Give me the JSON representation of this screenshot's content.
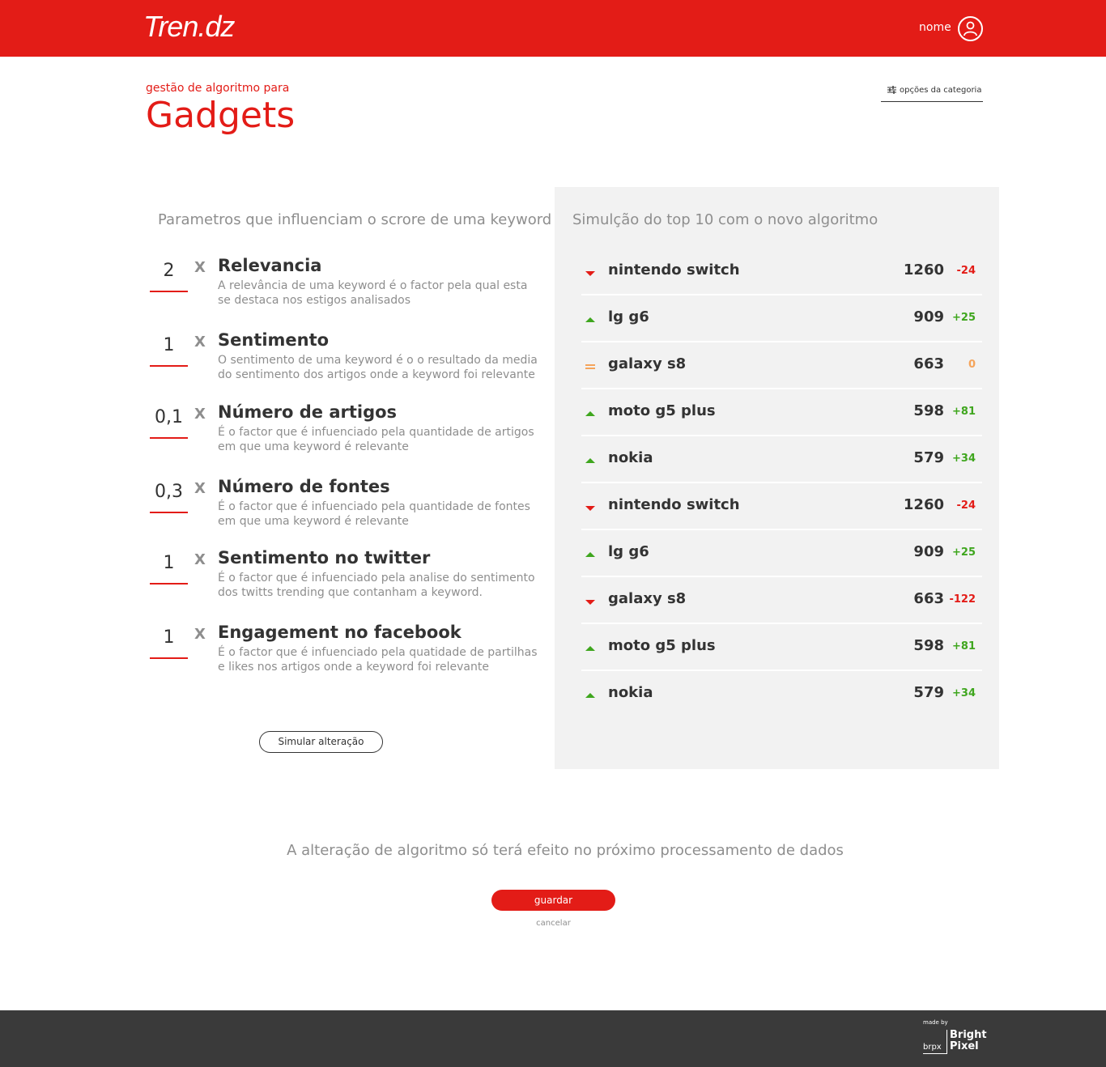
{
  "header": {
    "logo": "Tren.dz",
    "user_name": "nome"
  },
  "page": {
    "subtitle": "gestão de algoritmo para",
    "title": "Gadgets",
    "category_options": "opções da categoria"
  },
  "parameters": {
    "heading": "Parametros que influenciam o scrore de uma keyword",
    "multiplier_symbol": "X",
    "items": [
      {
        "value": "2",
        "title": "Relevancia",
        "description": "A relevância de uma keyword é o factor pela qual esta se destaca nos estigos analisados"
      },
      {
        "value": "1",
        "title": "Sentimento",
        "description": "O sentimento de uma keyword é o o resultado da media do sentimento dos artigos onde a keyword foi relevante"
      },
      {
        "value": "0,1",
        "title": "Número de artigos",
        "description": "É o factor que é infuenciado pela quantidade de artigos em que uma keyword é relevante"
      },
      {
        "value": "0,3",
        "title": "Número de fontes",
        "description": "É o factor que é infuenciado pela quantidade de fontes em que uma keyword é relevante"
      },
      {
        "value": "1",
        "title": "Sentimento no twitter",
        "description": "É o factor que é infuenciado pela analise do sentimento dos twitts trending que contanham a keyword."
      },
      {
        "value": "1",
        "title": "Engagement no facebook",
        "description": "É o factor que é infuenciado pela quatidade de partilhas e likes nos artigos onde a keyword foi relevante"
      }
    ],
    "simulate_button": "Simular alteração"
  },
  "simulation": {
    "heading": "Simulção do top 10 com o novo algoritmo",
    "rows": [
      {
        "trend": "down",
        "keyword": "nintendo switch",
        "score": "1260",
        "delta": "-24"
      },
      {
        "trend": "up",
        "keyword": "lg g6",
        "score": "909",
        "delta": "+25"
      },
      {
        "trend": "eq",
        "keyword": "galaxy s8",
        "score": "663",
        "delta": "0"
      },
      {
        "trend": "up",
        "keyword": "moto g5 plus",
        "score": "598",
        "delta": "+81"
      },
      {
        "trend": "up",
        "keyword": "nokia",
        "score": "579",
        "delta": "+34"
      },
      {
        "trend": "down",
        "keyword": "nintendo switch",
        "score": "1260",
        "delta": "-24"
      },
      {
        "trend": "up",
        "keyword": "lg g6",
        "score": "909",
        "delta": "+25"
      },
      {
        "trend": "down",
        "keyword": "galaxy s8",
        "score": "663",
        "delta": "-122"
      },
      {
        "trend": "up",
        "keyword": "moto g5 plus",
        "score": "598",
        "delta": "+81"
      },
      {
        "trend": "up",
        "keyword": "nokia",
        "score": "579",
        "delta": "+34"
      }
    ]
  },
  "actions": {
    "notice": "A alteração de algoritmo só terá efeito no próximo processamento de dados",
    "save_button": "guardar",
    "cancel_link": "cancelar"
  },
  "footer": {
    "made_by": "made by",
    "brand_short": "brpx",
    "brand_line1": "Bright",
    "brand_line2": "Pixel"
  },
  "colors": {
    "brand_red": "#e31c17",
    "up_green": "#3fa61e",
    "equal_orange": "#f5a45b",
    "panel_gray": "#f2f2f2",
    "footer_dark": "#3a3a3a"
  }
}
